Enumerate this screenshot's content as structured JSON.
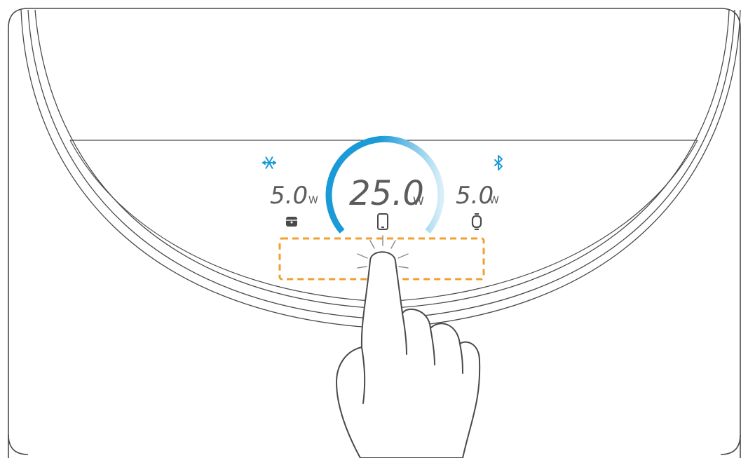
{
  "display": {
    "left": {
      "value": "5.0",
      "unit": "W",
      "device_icon": "wireless-earbuds-case-icon",
      "status_icon": "snowflake-icon"
    },
    "center": {
      "value": "25.0",
      "unit": "W",
      "device_icon": "phone-icon",
      "progress": 0.75
    },
    "right": {
      "value": "5.0",
      "unit": "W",
      "device_icon": "smartwatch-icon",
      "status_icon": "bluetooth-icon"
    }
  },
  "touch_zone": {
    "highlight_icon": "tap-hand-icon"
  },
  "colors": {
    "outline": "#4a4a4a",
    "readout": "#5c5c5f",
    "accent": "#1a9ad6",
    "accent_fade": "#d8eef9",
    "touch_highlight": "#f0a030"
  }
}
